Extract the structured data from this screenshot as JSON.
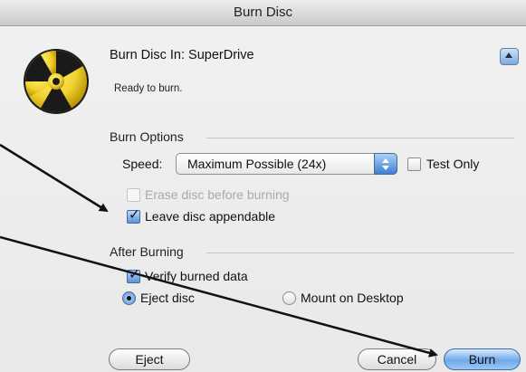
{
  "window": {
    "title": "Burn Disc"
  },
  "header": {
    "drive_label": "Burn Disc In: SuperDrive",
    "status": "Ready to burn."
  },
  "burn_options": {
    "label": "Burn Options",
    "speed_label": "Speed:",
    "speed_selected": "Maximum Possible (24x)",
    "test_only": {
      "label": "Test Only",
      "checked": false
    },
    "erase_disc": {
      "label": "Erase disc before burning",
      "checked": false,
      "enabled": false
    },
    "leave_appendable": {
      "label": "Leave disc appendable",
      "checked": true
    }
  },
  "after_burning": {
    "label": "After Burning",
    "verify": {
      "label": "Verify burned data",
      "checked": true
    },
    "eject_option": {
      "label": "Eject disc",
      "selected": true
    },
    "mount_option": {
      "label": "Mount on Desktop",
      "selected": false
    }
  },
  "buttons": {
    "eject": "Eject",
    "cancel": "Cancel",
    "burn": "Burn"
  },
  "icons": {
    "burn": "burn-radiation-icon",
    "disclosure": "disclosure-triangle-icon"
  },
  "colors": {
    "accent": "#5a93d9",
    "burn_icon_yellow": "#f2d230",
    "burn_icon_dark": "#1a1a1a"
  }
}
